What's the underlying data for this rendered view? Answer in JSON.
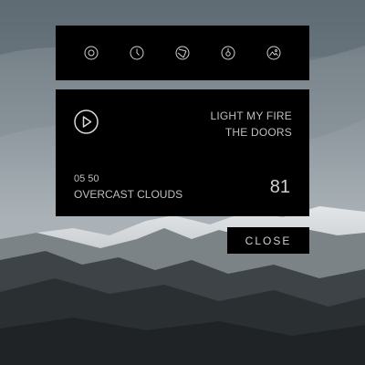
{
  "toolbar": {
    "icons": [
      "target-icon",
      "clock-icon",
      "aperture-icon",
      "pin-icon",
      "image-icon"
    ]
  },
  "player": {
    "title": "LIGHT MY FIRE",
    "artist": "THE DOORS",
    "play_icon": "play-icon"
  },
  "weather": {
    "time": "05 50",
    "condition": "OVERCAST CLOUDS",
    "temperature": "81"
  },
  "actions": {
    "close_label": "CLOSE"
  },
  "colors": {
    "panel": "#000000",
    "text": "#bfbfbf"
  }
}
